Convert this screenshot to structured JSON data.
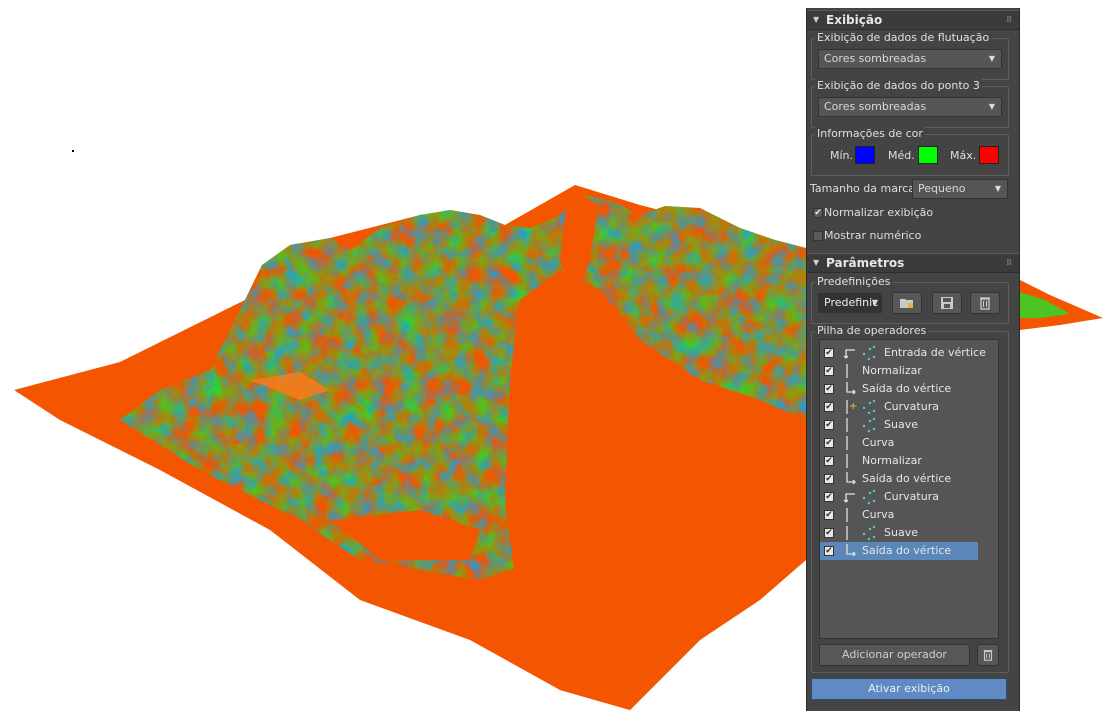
{
  "display_rollout": {
    "title": "Exibição",
    "float_display": {
      "label": "Exibição de dados de flutuação",
      "value": "Cores sombreadas"
    },
    "point3_display": {
      "label": "Exibição de dados do ponto 3",
      "value": "Cores sombreadas"
    },
    "color_info": {
      "label": "Informações de cor",
      "min_label": "Mín.",
      "min_color": "#0000ff",
      "mid_label": "Méd.",
      "mid_color": "#00ff00",
      "max_label": "Máx.",
      "max_color": "#ff0000"
    },
    "marker_size": {
      "label": "Tamanho da marca",
      "value": "Pequeno"
    },
    "normalize_display": {
      "label": "Normalizar exibição",
      "checked": true
    },
    "show_numeric": {
      "label": "Mostrar numérico",
      "checked": false
    }
  },
  "parameters_rollout": {
    "title": "Parâmetros",
    "presets": {
      "label": "Predefinições",
      "value": "Predefinic"
    },
    "operator_stack": {
      "label": "Pilha de operadores",
      "items": [
        {
          "name": "Entrada de vértice",
          "tree": "in",
          "icon": "vertex-icon",
          "checked": true
        },
        {
          "name": "Normalizar",
          "tree": "bar",
          "icon": "",
          "checked": true
        },
        {
          "name": "Saída do vértice",
          "tree": "out",
          "icon": "",
          "checked": true
        },
        {
          "name": "Curvatura",
          "tree": "plus",
          "icon": "vertex-icon",
          "checked": true
        },
        {
          "name": "Suave",
          "tree": "bar",
          "icon": "vertex-icon",
          "checked": true
        },
        {
          "name": "Curva",
          "tree": "bar",
          "icon": "",
          "checked": true
        },
        {
          "name": "Normalizar",
          "tree": "bar",
          "icon": "",
          "checked": true
        },
        {
          "name": "Saída do vértice",
          "tree": "out",
          "icon": "",
          "checked": true
        },
        {
          "name": "Curvatura",
          "tree": "in",
          "icon": "vertex-icon",
          "checked": true
        },
        {
          "name": "Curva",
          "tree": "bar",
          "icon": "",
          "checked": true
        },
        {
          "name": "Suave",
          "tree": "bar",
          "icon": "vertex-icon",
          "checked": true
        },
        {
          "name": "Saída do vértice",
          "tree": "out",
          "icon": "",
          "checked": true,
          "selected": true
        }
      ]
    },
    "add_operator_label": "Adicionar operador",
    "activate_label": "Ativar exibição"
  },
  "colors": {
    "terrain_base": "#f35500",
    "terrain_mid": "#22e02a",
    "terrain_low": "#1aa0e0",
    "selection": "#5a86b8",
    "activate": "#5f8ac4"
  }
}
